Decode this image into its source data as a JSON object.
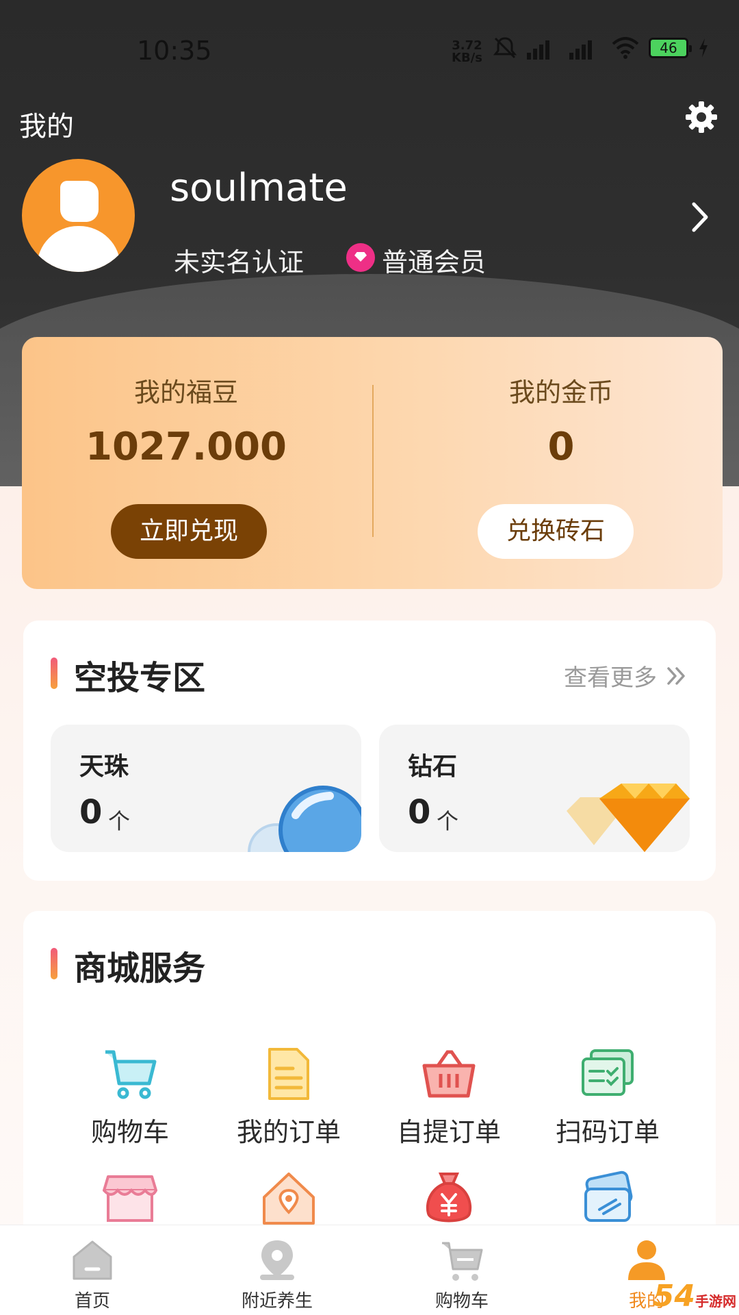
{
  "status_bar": {
    "time": "10:35",
    "net_speed_value": "3.72",
    "net_speed_unit": "KB/s",
    "battery": "46"
  },
  "header": {
    "title": "我的",
    "username": "soulmate",
    "verify_status": "未实名认证",
    "member_level": "普通会员"
  },
  "points": {
    "fudou_label": "我的福豆",
    "fudou_value": "1027.000",
    "fudou_button": "立即兑现",
    "gold_label": "我的金币",
    "gold_value": "0",
    "gold_button": "兑换砖石"
  },
  "airdrop": {
    "title": "空投专区",
    "more": "查看更多",
    "tiles": [
      {
        "name": "天珠",
        "count": "0",
        "unit": "个"
      },
      {
        "name": "钻石",
        "count": "0",
        "unit": "个"
      }
    ]
  },
  "mall": {
    "title": "商城服务",
    "items": [
      {
        "label": "购物车",
        "icon": "cart-icon"
      },
      {
        "label": "我的订单",
        "icon": "document-icon"
      },
      {
        "label": "自提订单",
        "icon": "basket-icon"
      },
      {
        "label": "扫码订单",
        "icon": "scan-cards-icon"
      },
      {
        "label": "",
        "icon": "shop-icon"
      },
      {
        "label": "",
        "icon": "house-location-icon"
      },
      {
        "label": "",
        "icon": "money-bag-icon"
      },
      {
        "label": "",
        "icon": "card-icon"
      }
    ]
  },
  "bottom_nav": {
    "items": [
      {
        "label": "首页"
      },
      {
        "label": "附近养生"
      },
      {
        "label": "购物车"
      },
      {
        "label": "我的"
      }
    ]
  },
  "colors": {
    "accent": "#f08a1f",
    "brand_brown": "#7a4205",
    "member_pink": "#ee2f86"
  }
}
